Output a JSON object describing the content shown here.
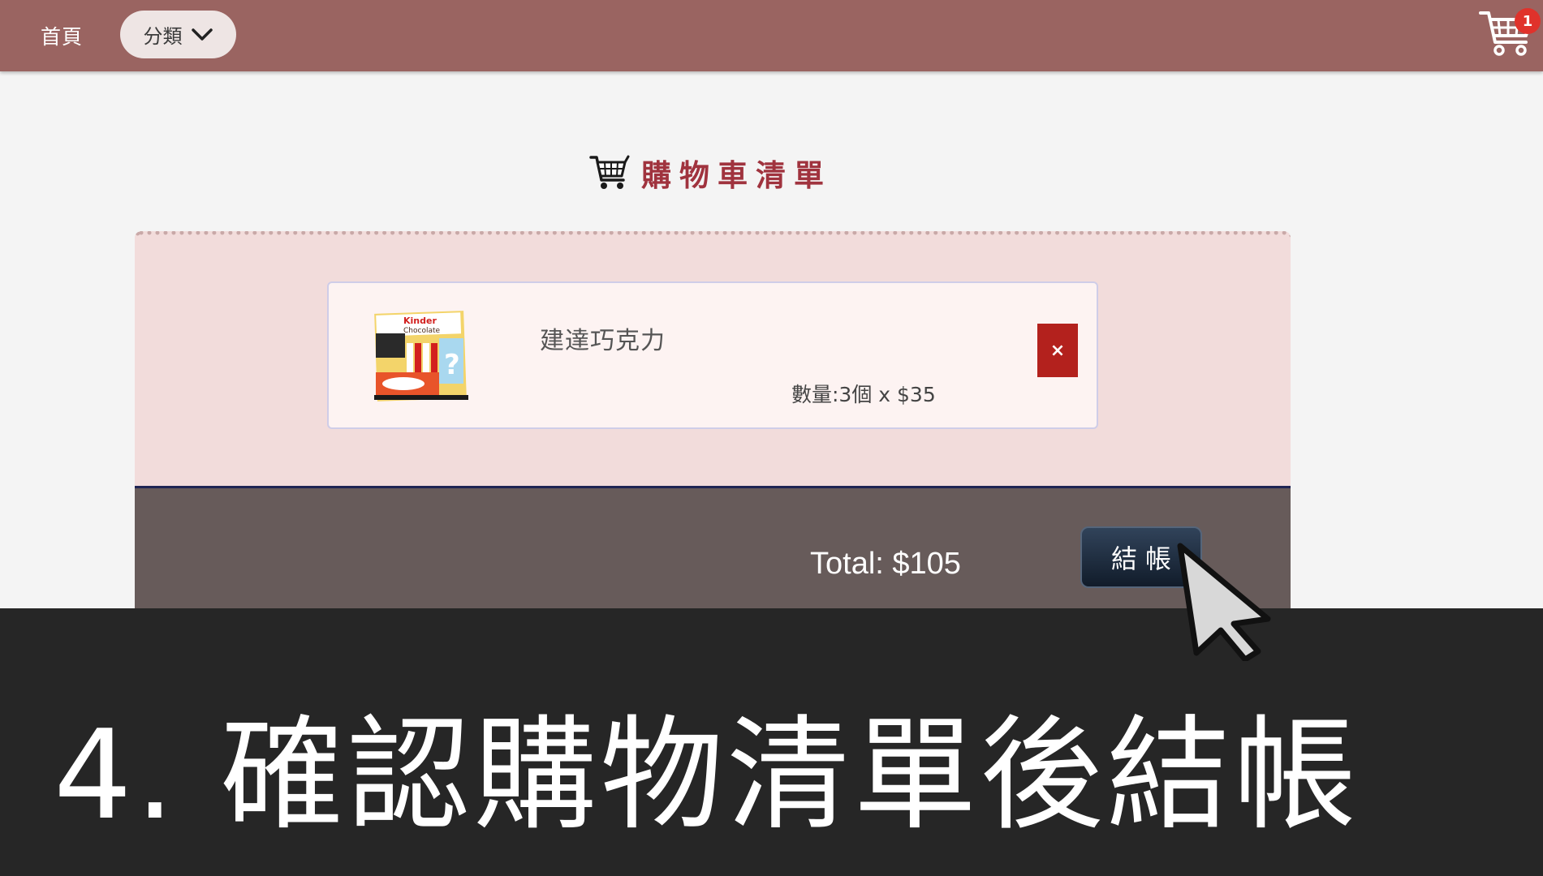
{
  "navbar": {
    "home_label": "首頁",
    "category_label": "分類",
    "cart_badge_count": "1",
    "background_color": "#9a6461"
  },
  "cart": {
    "heading": "購物車清單",
    "items": [
      {
        "name": "建達巧克力",
        "quantity_text": "數量:3個 x $35",
        "remove_label": "×",
        "image_icon": "kinder-chocolate-box-image"
      }
    ],
    "total_text": "Total: $105",
    "checkout_label": "結帳"
  },
  "caption": {
    "text": "4. 確認購物清單後結帳"
  },
  "colors": {
    "heading": "#a0333e",
    "panel": "#f2dcdb",
    "total_bar": "#675b5a",
    "remove_button": "#b3211d",
    "checkout_button": "#1f2a3a",
    "badge": "#e0322b"
  }
}
